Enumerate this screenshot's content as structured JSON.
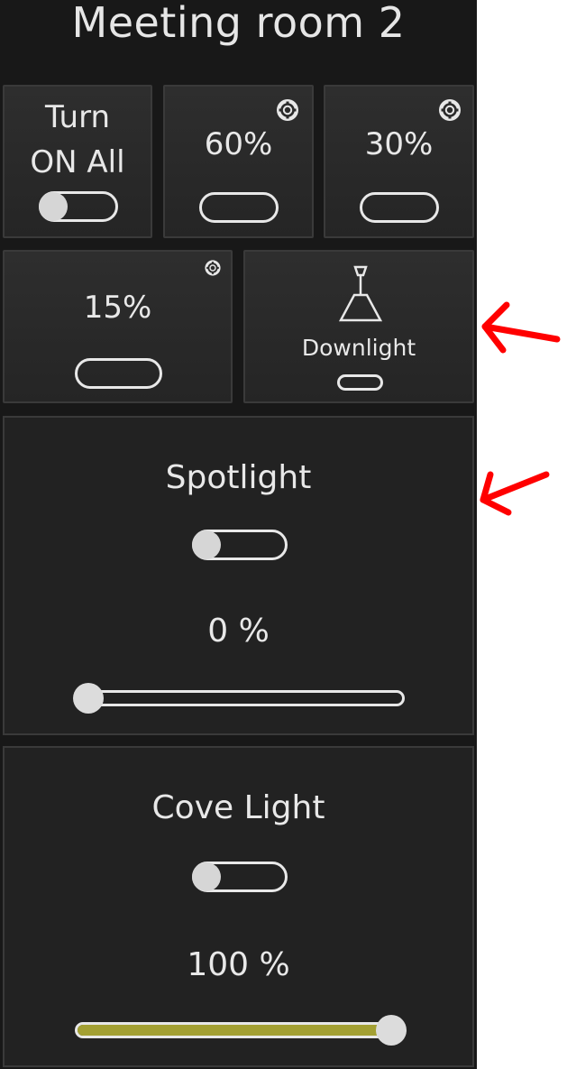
{
  "title": "Meeting room 2",
  "tiles": {
    "turn_on_all": {
      "line1": "Turn",
      "line2": "ON All",
      "toggle_on": false
    },
    "scene_60": {
      "label": "60%",
      "icon": "gear-icon"
    },
    "scene_30": {
      "label": "30%",
      "icon": "gear-icon"
    },
    "scene_15": {
      "label": "15%",
      "icon": "gear-icon"
    },
    "downlight": {
      "label": "Downlight",
      "icon": "pendant-lamp-icon"
    }
  },
  "cards": {
    "spotlight": {
      "name": "Spotlight",
      "toggle_on": false,
      "value_text": "0 %",
      "level": 0
    },
    "cove_light": {
      "name": "Cove Light",
      "toggle_on": false,
      "value_text": "100 %",
      "level": 1.0
    }
  },
  "colors": {
    "panel_bg": "#181818",
    "tile_bg": "#2b2b2b",
    "card_bg": "#222222",
    "slider_fill": "#a3a033",
    "annotation_arrow": "#ff0000"
  },
  "annotations": [
    "arrow-pointing-at-downlight-tile",
    "arrow-pointing-at-spotlight-card"
  ]
}
